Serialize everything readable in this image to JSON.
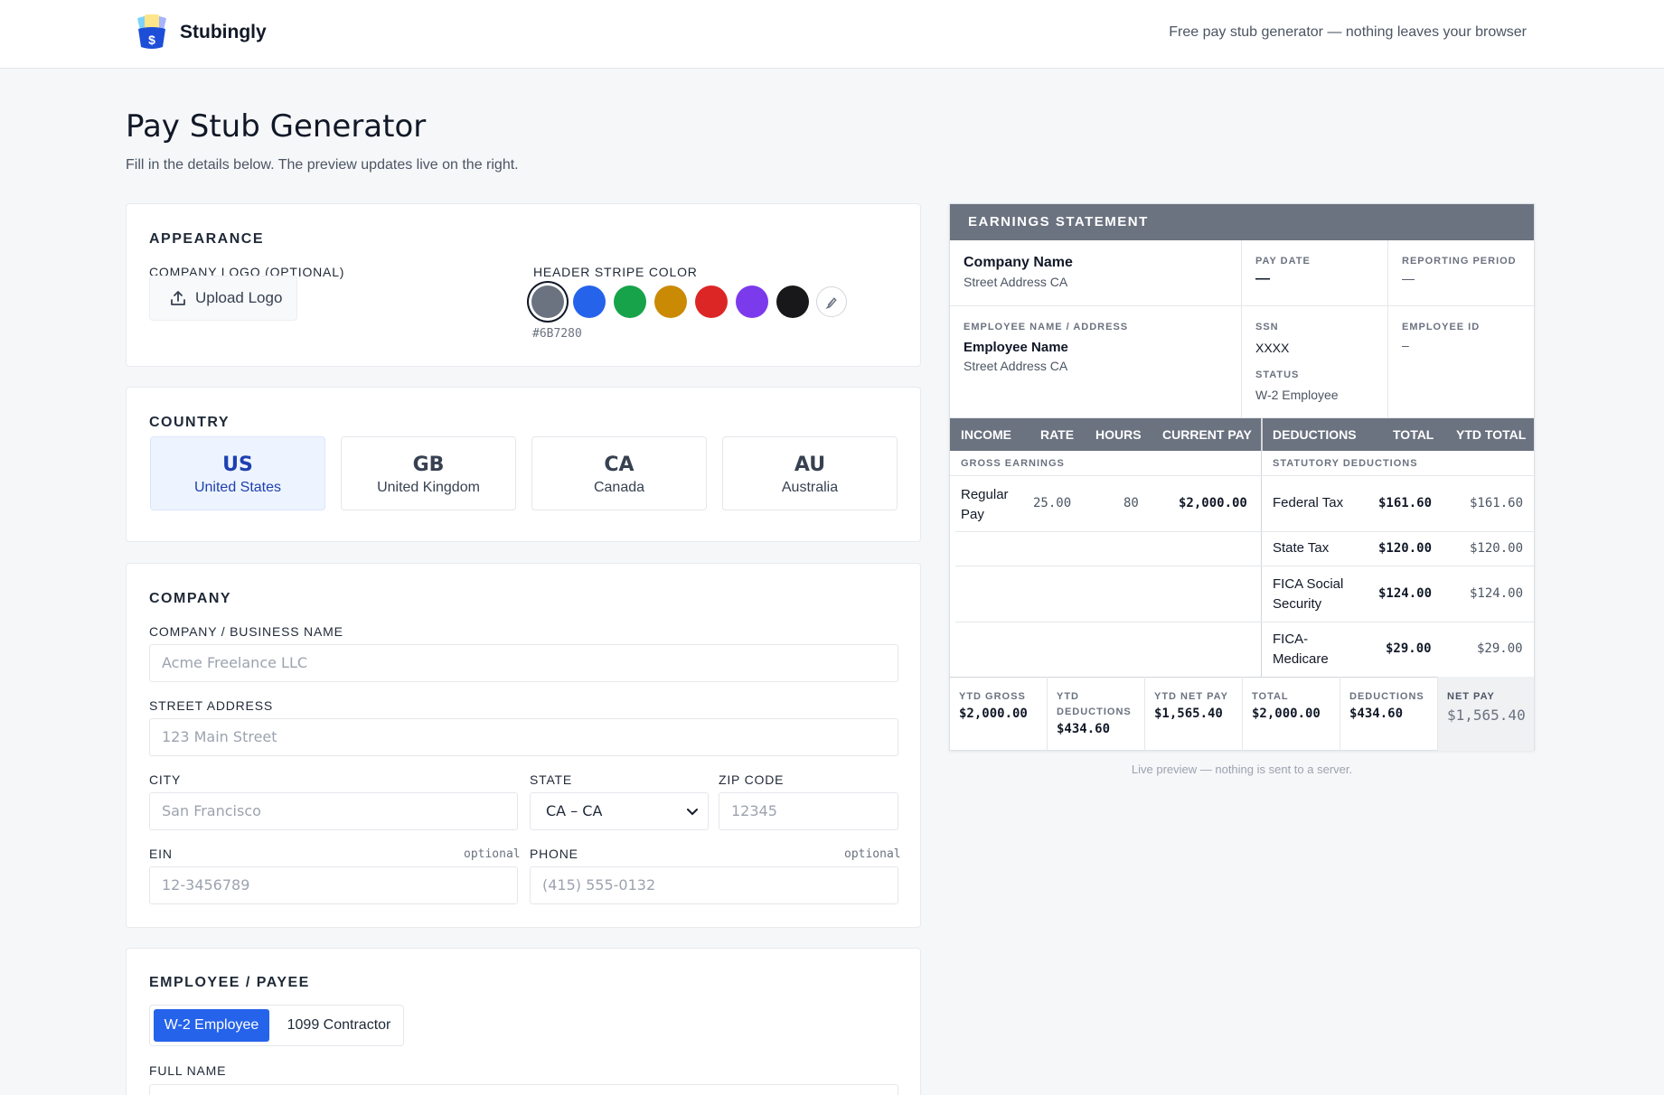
{
  "app": {
    "brand": "Stubingly",
    "tagline": "Free pay stub generator — nothing leaves your browser"
  },
  "page": {
    "title": "Pay Stub Generator",
    "subtitle": "Fill in the details below. The preview updates live on the right."
  },
  "appearance": {
    "section_title": "APPEARANCE",
    "logo_label": "COMPANY LOGO (OPTIONAL)",
    "upload_button": "Upload Logo",
    "stripe_label": "HEADER STRIPE COLOR",
    "selected_hex": "#6B7280",
    "swatches": [
      "#6B7280",
      "#2563EB",
      "#16A34A",
      "#CA8A04",
      "#DC2626",
      "#7C3AED",
      "#18181B"
    ],
    "custom_swatch_icon": "pencil-icon"
  },
  "country": {
    "section_title": "COUNTRY",
    "selected": "US",
    "options": [
      {
        "code": "US",
        "name": "United States"
      },
      {
        "code": "GB",
        "name": "United Kingdom"
      },
      {
        "code": "CA",
        "name": "Canada"
      },
      {
        "code": "AU",
        "name": "Australia"
      }
    ]
  },
  "company": {
    "section_title": "COMPANY",
    "name_label": "COMPANY / BUSINESS NAME",
    "name_placeholder": "Acme Freelance LLC",
    "address_label": "STREET ADDRESS",
    "address_placeholder": "123 Main Street",
    "city_label": "CITY",
    "city_placeholder": "San Francisco",
    "state_label": "STATE",
    "state_value": "CA – CA",
    "zip_label": "ZIP CODE",
    "zip_placeholder": "12345",
    "ein_label": "EIN",
    "ein_optional": "optional",
    "ein_placeholder": "12-3456789",
    "phone_label": "PHONE",
    "phone_optional": "optional",
    "phone_placeholder": "(415) 555-0132"
  },
  "employee": {
    "section_title": "EMPLOYEE / PAYEE",
    "type_options": [
      "W-2 Employee",
      "1099 Contractor"
    ],
    "type_selected": "W-2 Employee",
    "full_name_label": "FULL NAME"
  },
  "preview": {
    "header": "EARNINGS STATEMENT",
    "company_name": "Company Name",
    "company_address": "Street Address CA",
    "pay_date_label": "PAY DATE",
    "pay_date_value": "—",
    "period_label": "REPORTING PERIOD",
    "period_value": "—",
    "employee_label": "EMPLOYEE NAME / ADDRESS",
    "employee_name": "Employee Name",
    "employee_address": "Street Address CA",
    "ssn_label": "SSN",
    "ssn_value": "XXXX",
    "status_label": "STATUS",
    "status_value": "W-2 Employee",
    "employee_id_label": "EMPLOYEE ID",
    "employee_id_value": "–",
    "columns": {
      "income": "INCOME",
      "rate": "RATE",
      "hours": "HOURS",
      "current_pay": "CURRENT PAY",
      "deductions": "DEDUCTIONS",
      "total": "TOTAL",
      "ytd_total": "YTD TOTAL"
    },
    "gross_label": "GROSS EARNINGS",
    "statutory_label": "STATUTORY DEDUCTIONS",
    "earnings": [
      {
        "name_line1": "Regular",
        "name_line2": "Pay",
        "rate": "25.00",
        "hours": "80",
        "current": "$2,000.00"
      }
    ],
    "deductions": [
      {
        "name_line1": "Federal Tax",
        "name_line2": "",
        "total": "$161.60",
        "ytd": "$161.60"
      },
      {
        "name_line1": "State Tax",
        "name_line2": "",
        "total": "$120.00",
        "ytd": "$120.00"
      },
      {
        "name_line1": "FICA Social",
        "name_line2": "Security",
        "total": "$124.00",
        "ytd": "$124.00"
      },
      {
        "name_line1": "FICA-",
        "name_line2": "Medicare",
        "total": "$29.00",
        "ytd": "$29.00"
      }
    ],
    "footer": [
      {
        "label": "YTD GROSS",
        "value": "$2,000.00"
      },
      {
        "label": "YTD DEDUCTIONS",
        "value": "$434.60"
      },
      {
        "label": "YTD NET PAY",
        "value": "$1,565.40"
      },
      {
        "label": "TOTAL",
        "value": "$2,000.00"
      },
      {
        "label": "DEDUCTIONS",
        "value": "$434.60"
      },
      {
        "label": "NET PAY",
        "value": "$1,565.40"
      }
    ],
    "caption": "Live preview — nothing is sent to a server."
  }
}
